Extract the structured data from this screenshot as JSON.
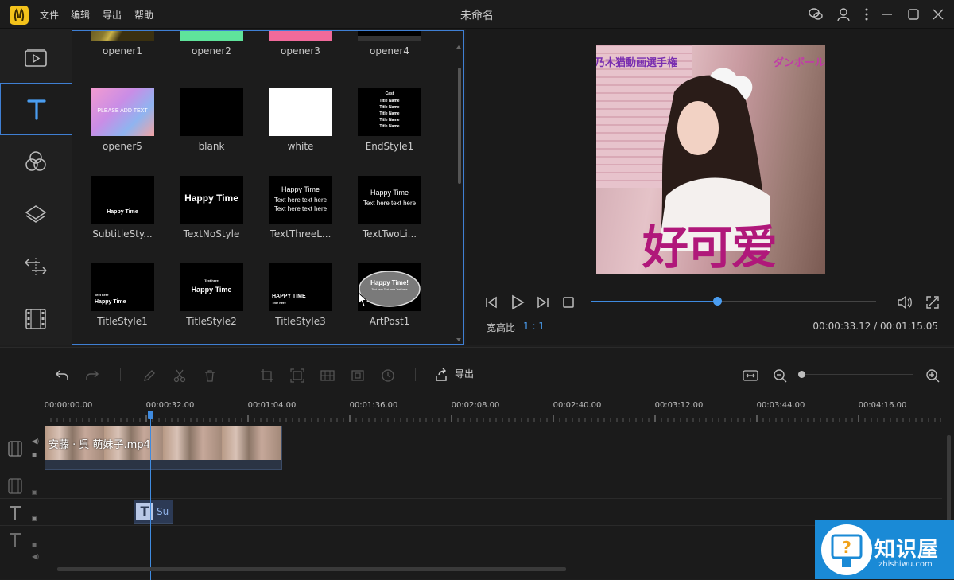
{
  "app": {
    "title": "未命名",
    "logo_glyph": "𝄞",
    "menu": [
      "文件",
      "编辑",
      "导出",
      "帮助"
    ]
  },
  "titlebar_icons": [
    "wechat-icon",
    "user-icon",
    "more-icon",
    "minimize-icon",
    "maximize-icon",
    "close-icon"
  ],
  "sidebar": {
    "items": [
      {
        "icon": "media-icon",
        "active": false
      },
      {
        "icon": "text-icon",
        "active": true
      },
      {
        "icon": "filter-icon",
        "active": false
      },
      {
        "icon": "overlay-icon",
        "active": false
      },
      {
        "icon": "transition-icon",
        "active": false
      },
      {
        "icon": "film-icon",
        "active": false
      }
    ]
  },
  "gallery": {
    "items": [
      {
        "label": "opener1",
        "thumb": "opener1"
      },
      {
        "label": "opener2",
        "thumb": "opener2"
      },
      {
        "label": "opener3",
        "thumb": "opener3"
      },
      {
        "label": "opener4",
        "thumb": "opener4"
      },
      {
        "label": "opener5",
        "thumb": "opener5",
        "thumb_text": "PLEASE ADD TEXT"
      },
      {
        "label": "blank",
        "thumb": "blank"
      },
      {
        "label": "white",
        "thumb": "white"
      },
      {
        "label": "EndStyle1",
        "thumb": "endstyle",
        "thumb_lines": [
          "Cast",
          "Title Name",
          "Title Name",
          "Title Name",
          "Title Name",
          "Title Name"
        ]
      },
      {
        "label": "SubtitleSty...",
        "thumb": "subtitle",
        "thumb_lines": [
          "Happy Time"
        ]
      },
      {
        "label": "TextNoStyle",
        "thumb": "textnostyle",
        "thumb_lines": [
          "Happy Time"
        ]
      },
      {
        "label": "TextThreeL...",
        "thumb": "textthree",
        "thumb_lines": [
          "Happy Time",
          "Text here text here",
          "Text here text here"
        ]
      },
      {
        "label": "TextTwoLi...",
        "thumb": "texttwo",
        "thumb_lines": [
          "Happy Time",
          "Text here text here"
        ]
      },
      {
        "label": "TitleStyle1",
        "thumb": "titlestyle1",
        "thumb_lines": [
          "Text here",
          "Happy Time"
        ]
      },
      {
        "label": "TitleStyle2",
        "thumb": "titlestyle2",
        "thumb_lines": [
          "Text here",
          "Happy Time"
        ]
      },
      {
        "label": "TitleStyle3",
        "thumb": "titlestyle3",
        "thumb_lines": [
          "HAPPY TIME",
          "Title here"
        ]
      },
      {
        "label": "ArtPost1",
        "thumb": "artpost1",
        "thumb_lines": [
          "Happy Time!",
          "Text here Text here Text here"
        ]
      }
    ]
  },
  "preview": {
    "overlay_top_left": "乃木猫動画選手権",
    "overlay_top_right": "ダンボール",
    "caption": "好可爱",
    "aspect_label": "宽高比",
    "aspect_value": "1 : 1",
    "time_current": "00:00:33.12",
    "time_total": "00:01:15.05",
    "time_readout": "00:00:33.12 / 00:01:15.05",
    "progress_fraction": 0.44
  },
  "timeline": {
    "toolbar": {
      "export_label": "导出",
      "tools": [
        "undo-icon",
        "redo-icon",
        "edit-icon",
        "cut-icon",
        "delete-icon",
        "crop-icon",
        "zoom-fit-icon",
        "mosaic-icon",
        "freeze-icon",
        "speed-icon"
      ]
    },
    "ruler": [
      "00:00:00.00",
      "00:00:32.00",
      "00:01:04.00",
      "00:01:36.00",
      "00:02:08.00",
      "00:02:40.00",
      "00:03:12.00",
      "00:03:44.00",
      "00:04:16.00"
    ],
    "video_clip_name": "安藤 · 呉 萌妹子.mp4",
    "text_clip_name": "Su",
    "text_clip_glyph": "T"
  },
  "watermark": {
    "title": "知识屋",
    "subtitle": "zhishiwu.com"
  },
  "colors": {
    "accent": "#3f8be0",
    "caption": "#b0187a",
    "watermark_bg": "#1a8ad6"
  }
}
